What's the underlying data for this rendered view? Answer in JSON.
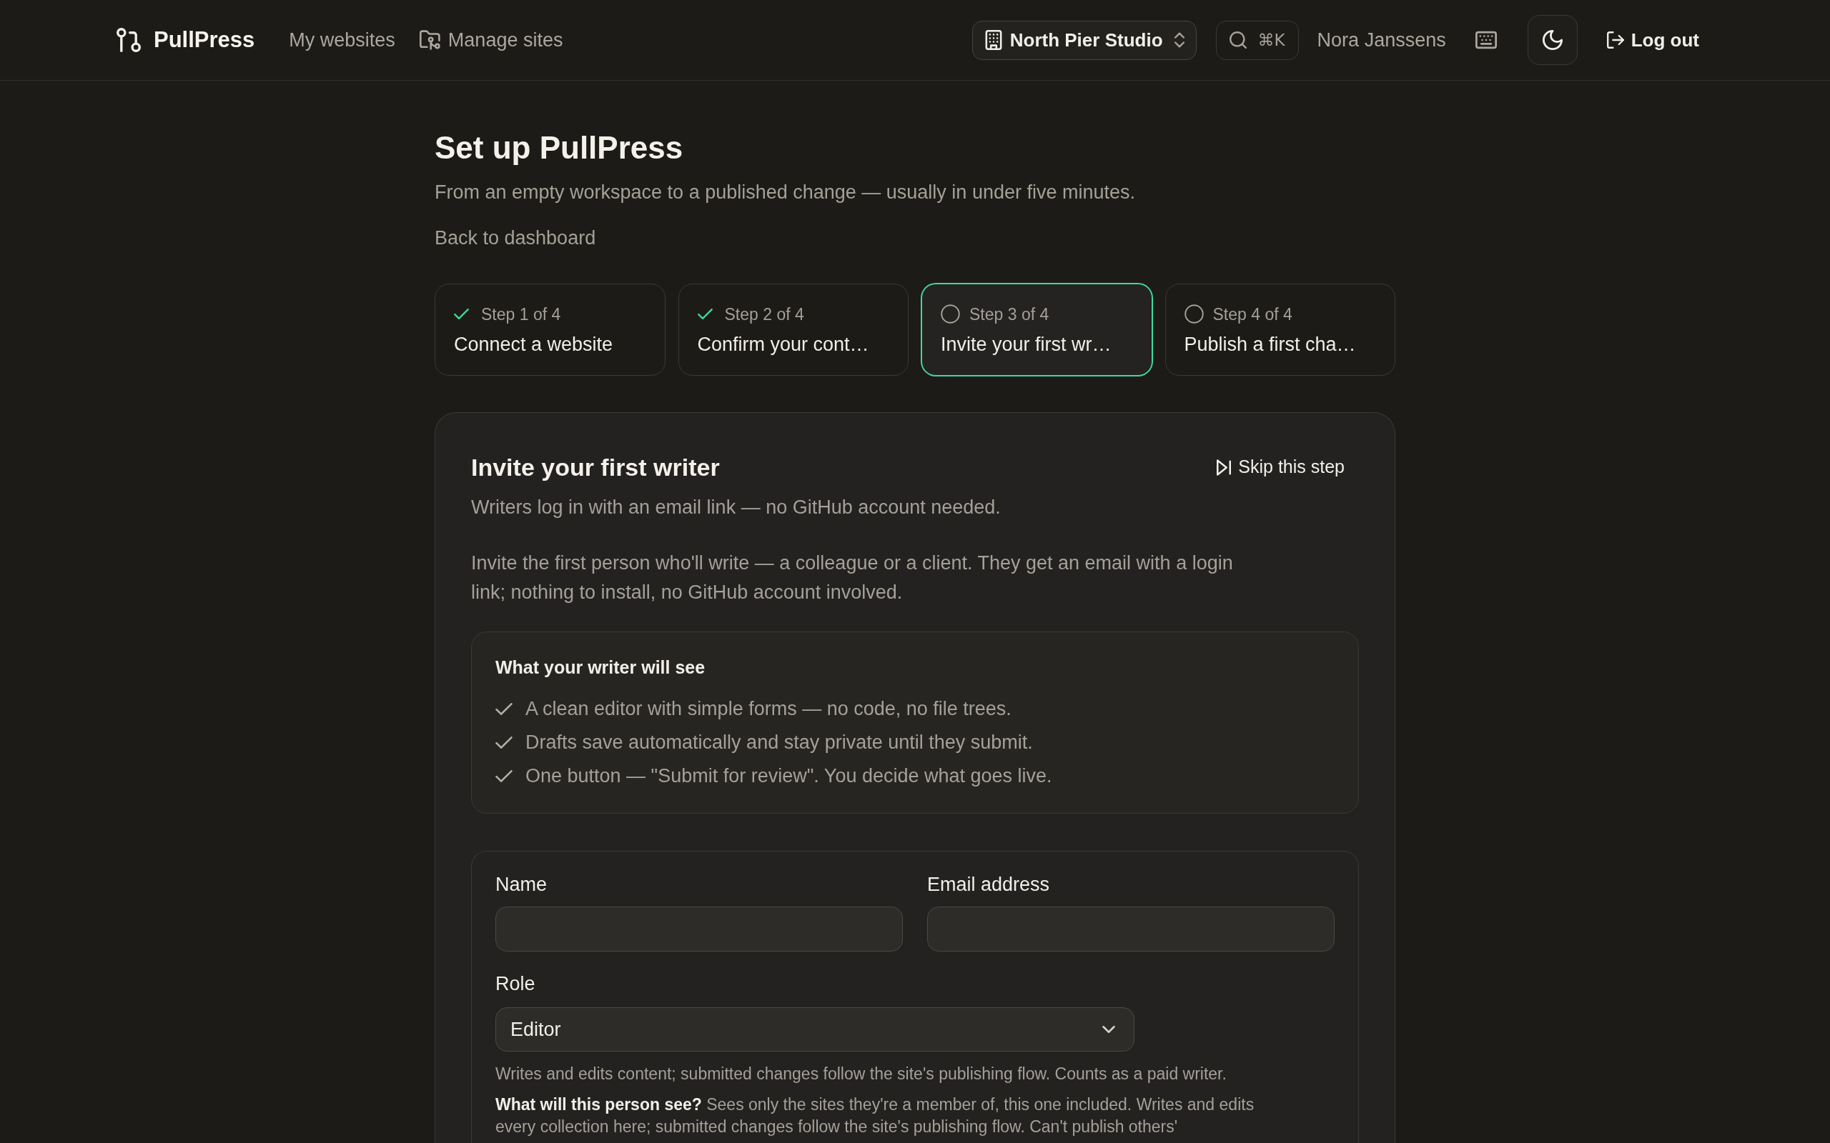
{
  "header": {
    "brand": "PullPress",
    "nav": [
      {
        "label": "My websites",
        "kind": "text"
      },
      {
        "label": "Manage sites",
        "kind": "folder"
      }
    ],
    "workspace": {
      "label": "North Pier Studio"
    },
    "search": {
      "shortcut": "⌘K"
    },
    "user_name": "Nora Janssens",
    "logout": {
      "label": "Log out"
    }
  },
  "page": {
    "title": "Set up PullPress",
    "subtitle": "From an empty workspace to a published change — usually in under five minutes.",
    "back_link": "Back to dashboard"
  },
  "steps": [
    {
      "label": "Step 1 of 4",
      "title": "Connect a website",
      "completed": true,
      "selected": false
    },
    {
      "label": "Step 2 of 4",
      "title": "Confirm your cont…",
      "completed": true,
      "selected": false
    },
    {
      "label": "Step 3 of 4",
      "title": "Invite your first wr…",
      "completed": false,
      "selected": true
    },
    {
      "label": "Step 4 of 4",
      "title": "Publish a first cha…",
      "completed": false,
      "selected": false
    }
  ],
  "card": {
    "title": "Invite your first writer",
    "skip_button": "Skip this step",
    "lead": "Writers log in with an email link — no GitHub account needed.",
    "intro": "Invite the first person who'll write — a colleague or a client. They get an email with a login link; nothing to install, no GitHub account involved.",
    "preview": {
      "title": "What your writer will see",
      "items": [
        "A clean editor with simple forms — no code, no file trees.",
        "Drafts save automatically and stay private until they submit.",
        "One button — \"Submit for review\". You decide what goes live."
      ]
    },
    "form": {
      "fields": [
        {
          "label": "Name"
        },
        {
          "label": "Email address"
        }
      ],
      "role": {
        "label": "Role",
        "value": "Editor",
        "help": "Writes and edits content; submitted changes follow the site's publishing flow. Counts as a paid writer."
      },
      "note": "**What will this person see?** Sees only the sites they're a member of, this one included. Writes and edits every collection here; submitted changes follow the site's publishing flow. Can't publish others'"
    }
  }
}
